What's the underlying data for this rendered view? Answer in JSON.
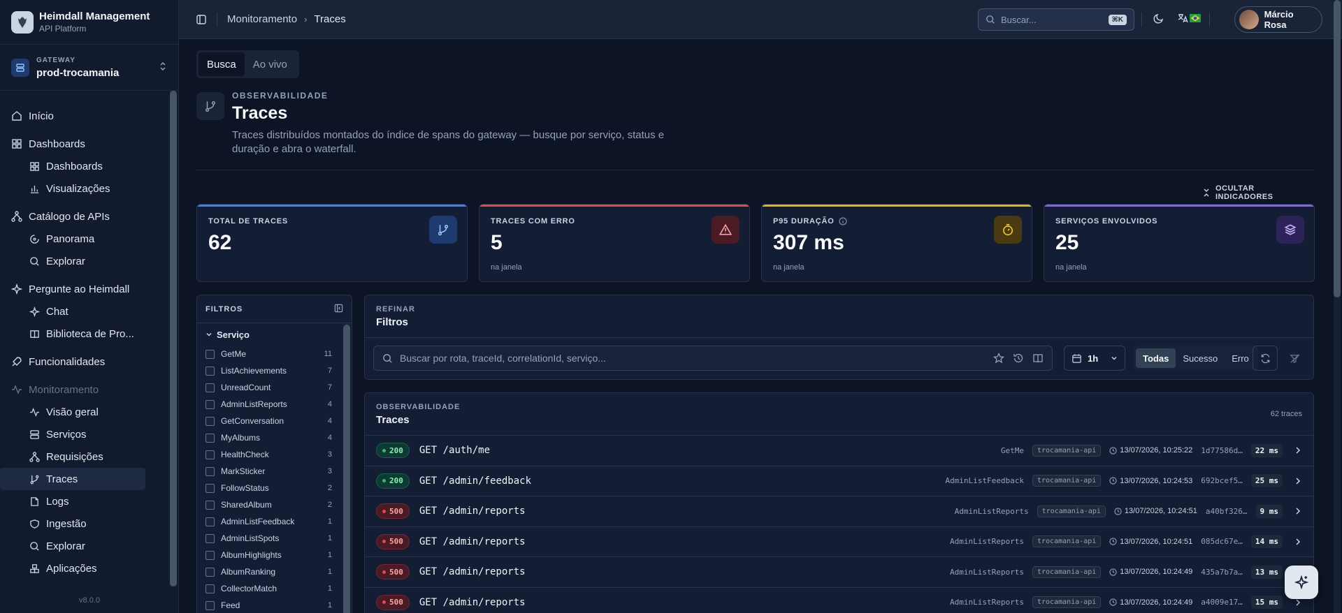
{
  "brand": {
    "title": "Heimdall Management",
    "subtitle": "API Platform"
  },
  "gateway": {
    "label": "GATEWAY",
    "name": "prod-trocamania"
  },
  "nav": {
    "inicio": "Início",
    "dashboards": {
      "label": "Dashboards",
      "items": [
        "Dashboards",
        "Visualizações"
      ]
    },
    "catalogo": {
      "label": "Catálogo de APIs",
      "items": [
        "Panorama",
        "Explorar"
      ]
    },
    "pergunte": {
      "label": "Pergunte ao Heimdall",
      "items": [
        "Chat",
        "Biblioteca de Pro..."
      ]
    },
    "funcionalidades": "Funcionalidades",
    "monitoramento": {
      "label": "Monitoramento",
      "items": [
        "Visão geral",
        "Serviços",
        "Requisições",
        "Traces",
        "Logs",
        "Ingestão",
        "Explorar",
        "Aplicações"
      ]
    }
  },
  "version": "v8.0.0",
  "header": {
    "breadcrumb": [
      "Monitoramento",
      "Traces"
    ],
    "search_placeholder": "Buscar...",
    "search_shortcut": "⌘K",
    "user_name": "Márcio Rosa"
  },
  "tabs": [
    "Busca",
    "Ao vivo"
  ],
  "page": {
    "eyebrow": "OBSERVABILIDADE",
    "title": "Traces",
    "description": "Traces distribuídos montados do índice de spans do gateway — busque por serviço, status e duração e abra o waterfall.",
    "hide_indicators": "OCULTAR INDICADORES"
  },
  "kpis": [
    {
      "label": "TOTAL DE TRACES",
      "value": "62",
      "sub": "",
      "color": "#3b82f6"
    },
    {
      "label": "TRACES COM ERRO",
      "value": "5",
      "sub": "na janela",
      "color": "#ef4444"
    },
    {
      "label": "P95 DURAÇÃO",
      "value": "307 ms",
      "sub": "na janela",
      "color": "#eab308"
    },
    {
      "label": "SERVIÇOS ENVOLVIDOS",
      "value": "25",
      "sub": "na janela",
      "color": "#8b5cf6"
    }
  ],
  "filters": {
    "title": "FILTROS",
    "group": "Serviço",
    "items": [
      {
        "name": "GetMe",
        "count": "11"
      },
      {
        "name": "ListAchievements",
        "count": "7"
      },
      {
        "name": "UnreadCount",
        "count": "7"
      },
      {
        "name": "AdminListReports",
        "count": "4"
      },
      {
        "name": "GetConversation",
        "count": "4"
      },
      {
        "name": "MyAlbums",
        "count": "4"
      },
      {
        "name": "HealthCheck",
        "count": "3"
      },
      {
        "name": "MarkSticker",
        "count": "3"
      },
      {
        "name": "FollowStatus",
        "count": "2"
      },
      {
        "name": "SharedAlbum",
        "count": "2"
      },
      {
        "name": "AdminListFeedback",
        "count": "1"
      },
      {
        "name": "AdminListSpots",
        "count": "1"
      },
      {
        "name": "AlbumHighlights",
        "count": "1"
      },
      {
        "name": "AlbumRanking",
        "count": "1"
      },
      {
        "name": "CollectorMatch",
        "count": "1"
      },
      {
        "name": "Feed",
        "count": "1"
      }
    ]
  },
  "refine": {
    "eyebrow": "REFINAR",
    "title": "Filtros",
    "search_placeholder": "Buscar por rota, traceId, correlationId, serviço...",
    "time_range": "1h",
    "segments": [
      "Todas",
      "Sucesso",
      "Erro"
    ]
  },
  "traces": {
    "eyebrow": "OBSERVABILIDADE",
    "title": "Traces",
    "count": "62 traces",
    "rows": [
      {
        "status": "200",
        "route": "GET /auth/me",
        "op": "GetMe",
        "service": "trocamania-api",
        "time": "13/07/2026, 10:25:22",
        "trace": "1d77586d…",
        "duration": "22 ms"
      },
      {
        "status": "200",
        "route": "GET /admin/feedback",
        "op": "AdminListFeedback",
        "service": "trocamania-api",
        "time": "13/07/2026, 10:24:53",
        "trace": "692bcef5…",
        "duration": "25 ms"
      },
      {
        "status": "500",
        "route": "GET /admin/reports",
        "op": "AdminListReports",
        "service": "trocamania-api",
        "time": "13/07/2026, 10:24:51",
        "trace": "a40bf326…",
        "duration": "9 ms"
      },
      {
        "status": "500",
        "route": "GET /admin/reports",
        "op": "AdminListReports",
        "service": "trocamania-api",
        "time": "13/07/2026, 10:24:51",
        "trace": "085dc67e…",
        "duration": "14 ms"
      },
      {
        "status": "500",
        "route": "GET /admin/reports",
        "op": "AdminListReports",
        "service": "trocamania-api",
        "time": "13/07/2026, 10:24:49",
        "trace": "435a7b7a…",
        "duration": "13 ms"
      },
      {
        "status": "500",
        "route": "GET /admin/reports",
        "op": "AdminListReports",
        "service": "trocamania-api",
        "time": "13/07/2026, 10:24:49",
        "trace": "a4009e17…",
        "duration": "15 ms"
      }
    ]
  }
}
